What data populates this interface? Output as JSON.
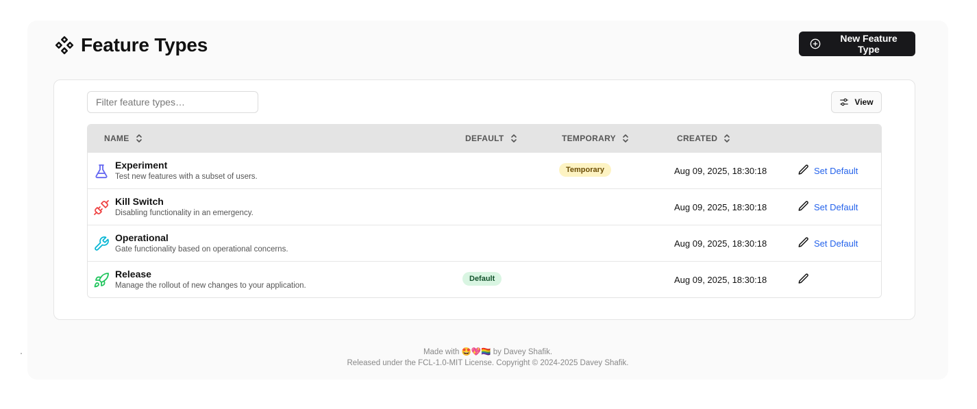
{
  "header": {
    "title": "Feature Types",
    "new_button_label": "New Feature Type"
  },
  "toolbar": {
    "filter_placeholder": "Filter feature types…",
    "view_label": "View"
  },
  "table": {
    "columns": {
      "name": "NAME",
      "default": "DEFAULT",
      "temporary": "TEMPORARY",
      "created": "CREATED"
    },
    "rows": [
      {
        "name": "Experiment",
        "description": "Test new features with a subset of users.",
        "icon": "flask-icon",
        "icon_color": "#6366f1",
        "default_badge": null,
        "temporary_badge": "Temporary",
        "created": "Aug 09, 2025, 18:30:18",
        "action": "Set Default"
      },
      {
        "name": "Kill Switch",
        "description": "Disabling functionality in an emergency.",
        "icon": "unplug-icon",
        "icon_color": "#ef4444",
        "default_badge": null,
        "temporary_badge": null,
        "created": "Aug 09, 2025, 18:30:18",
        "action": "Set Default"
      },
      {
        "name": "Operational",
        "description": "Gate functionality based on operational concerns.",
        "icon": "wrench-icon",
        "icon_color": "#06b6d4",
        "default_badge": null,
        "temporary_badge": null,
        "created": "Aug 09, 2025, 18:30:18",
        "action": "Set Default"
      },
      {
        "name": "Release",
        "description": "Manage the rollout of new changes to your application.",
        "icon": "rocket-icon",
        "icon_color": "#22c55e",
        "default_badge": "Default",
        "temporary_badge": null,
        "created": "Aug 09, 2025, 18:30:18",
        "action": null
      }
    ]
  },
  "footer": {
    "line1_prefix": "Made with",
    "line1_emoji": "🤩💖🏳️‍🌈",
    "line1_suffix": "by Davey Shafik.",
    "line2": "Released under the FCL-1.0-MIT License. Copyright © 2024-2025 Davey Shafik."
  },
  "colors": {
    "primary_button": "#18181b",
    "link": "#2563eb",
    "temporary_badge_bg": "#fdf3c3",
    "default_badge_bg": "#d9f5e2"
  }
}
